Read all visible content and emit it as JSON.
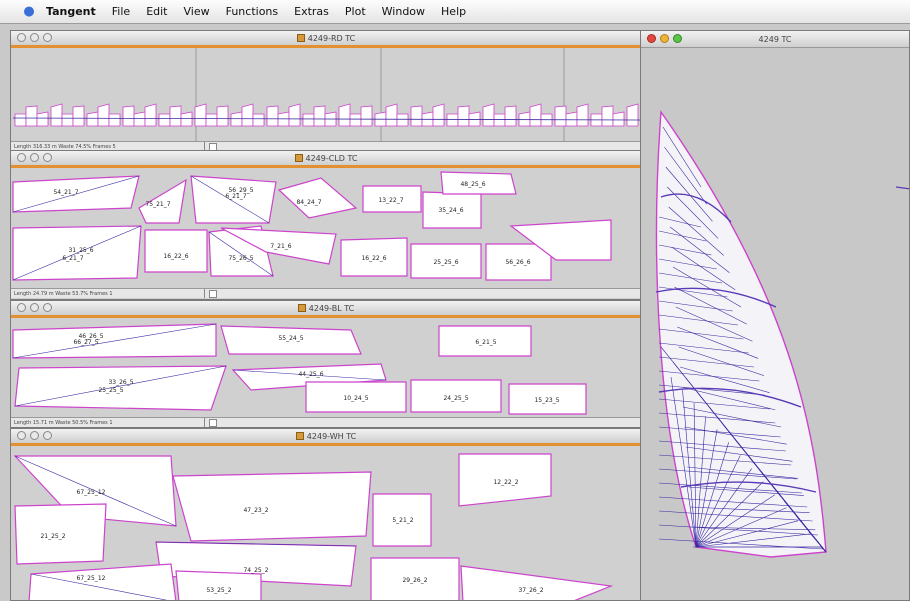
{
  "menubar": {
    "app": "Tangent",
    "items": [
      "File",
      "Edit",
      "View",
      "Functions",
      "Extras",
      "Plot",
      "Window",
      "Help"
    ]
  },
  "windows": {
    "rd": {
      "title": "4249-RD TC",
      "status": "Length 316.33 m Waste 74.5% Frames 5"
    },
    "cld": {
      "title": "4249-CLD TC",
      "status": "Length 24.79 m Waste 53.7% Frames 1",
      "labels": [
        "54_21_7",
        "75_21_7",
        "56_29_5",
        "6_21_7",
        "84_24_7",
        "13_22_7",
        "35_24_6",
        "48_25_6",
        "31_25_6",
        "6_21_7",
        "16_22_6",
        "75_26_5",
        "7_21_6",
        "16_22_6",
        "25_25_6",
        "56_26_6"
      ]
    },
    "bl": {
      "title": "4249-BL TC",
      "status": "Length 15.71 m Waste 50.5% Frames 1",
      "labels": [
        "46_26_5",
        "66_27_5",
        "55_24_5",
        "6_21_5",
        "44_25_6",
        "33_26_5",
        "25_25_5",
        "10_24_5",
        "24_25_5",
        "15_23_5"
      ]
    },
    "wh": {
      "title": "4249-WH TC",
      "labels": [
        "67_25_12",
        "47_23_2",
        "12_22_2",
        "5_21_2",
        "21_25_2",
        "74_25_2",
        "67_25_12",
        "53_25_2",
        "29_26_2",
        "37_26_2"
      ]
    },
    "sail": {
      "title": "4249 TC"
    }
  },
  "colors": {
    "accent": "#e39030",
    "panel_edge": "#cc44cc",
    "seam": "#3a2aa0"
  }
}
